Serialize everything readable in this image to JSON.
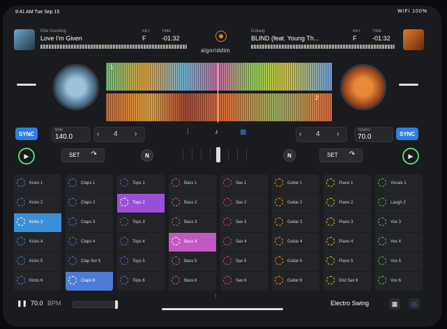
{
  "status": {
    "time": "9:41 AM  Tue Sep 15",
    "system": "WiFi 100%"
  },
  "deckA": {
    "artist": "Ellie Goulding",
    "title": "Love I'm Given",
    "key_label": "KEY",
    "key": "F",
    "time_label": "TIME",
    "time": "-01:32",
    "bpm_label": "BPM",
    "bpm": "140.0",
    "marker": "1",
    "sync": "SYNC",
    "set": "SET"
  },
  "deckB": {
    "artist": "Dollady",
    "title": "BLIND (feat. Young Th...",
    "key_label": "KEY",
    "key": "F",
    "time_label": "TIME",
    "time": "-01:32",
    "bpm_label": "TEMPO",
    "bpm": "70.0",
    "marker": "2",
    "sync": "SYNC",
    "set": "SET"
  },
  "logo": "algoriddim",
  "loop_a": "4",
  "loop_b": "4",
  "n_button": "N",
  "pad_columns": [
    {
      "color": "#3b8fd8",
      "active": 2,
      "pads": [
        "Kicks 1",
        "Kicks 2",
        "Kicks 3",
        "Kicks 4",
        "Kicks 5",
        "Kicks 6"
      ]
    },
    {
      "color": "#4e7bd8",
      "active": 5,
      "pads": [
        "Claps 1",
        "Claps 2",
        "Claps 3",
        "Claps 4",
        "Clap Snr 5",
        "Claps 6"
      ]
    },
    {
      "color": "#9a4fd8",
      "active": 1,
      "pads": [
        "Tops 1",
        "Tops 2",
        "Tops 3",
        "Tops 4",
        "Tops 5",
        "Tops 6"
      ]
    },
    {
      "color": "#c05ac0",
      "active": 3,
      "pads": [
        "Bass 1",
        "Bass 2",
        "Bass 3",
        "Bass 4",
        "Bass 5",
        "Bass 6"
      ]
    },
    {
      "color": "#d84a6a",
      "active": -1,
      "pads": [
        "Sax 1",
        "Sax 2",
        "Sax 3",
        "Sax 4",
        "Sax 5",
        "Sax 6"
      ]
    },
    {
      "color": "#e8a030",
      "active": -1,
      "pads": [
        "Guitar 1",
        "Guitar 2",
        "Guitar 3",
        "Guitar 4",
        "Guitar 5",
        "Guitar 6"
      ]
    },
    {
      "color": "#e8c030",
      "active": -1,
      "pads": [
        "Piano 1",
        "Piano 2",
        "Piano 3",
        "Piano 4",
        "Piano 5",
        "Dist Sax 6"
      ]
    },
    {
      "color": "#5fc05a",
      "active": -1,
      "pads": [
        "Vocals 1",
        "Laugh 2",
        "Vox 3",
        "Vox 4",
        "Vox 5",
        "Vox 6"
      ]
    }
  ],
  "bottom": {
    "bpm": "70.0",
    "bpm_label": "BPM",
    "pack": "Electro Swing"
  }
}
